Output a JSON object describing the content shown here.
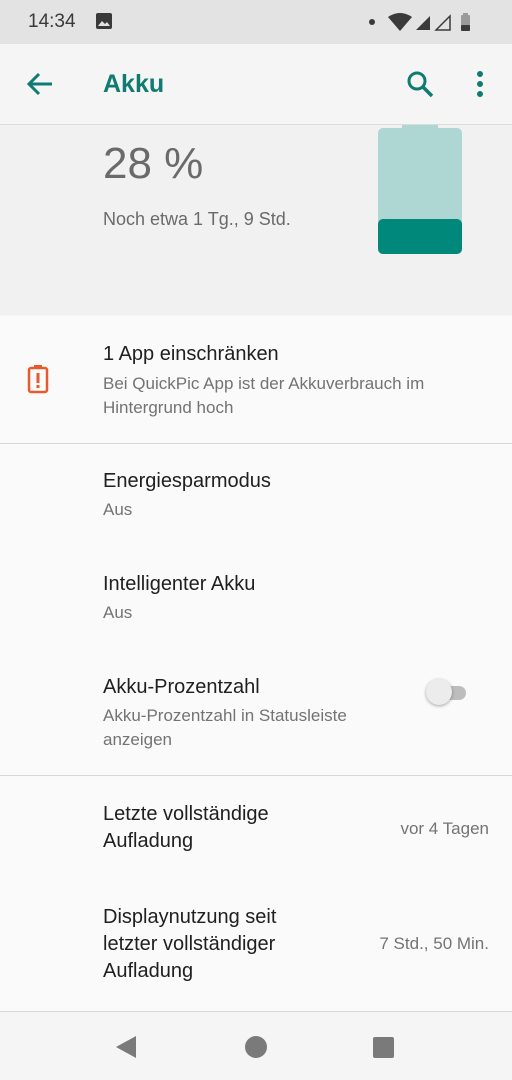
{
  "status_bar": {
    "time": "14:34"
  },
  "app_bar": {
    "title": "Akku",
    "accent_color": "#0f7b71"
  },
  "battery": {
    "percent_text": "28 %",
    "level_fraction": 0.28,
    "remaining": "Noch etwa 1 Tg., 9 Std.",
    "fill_color": "#00897b",
    "empty_color": "#aed7d3"
  },
  "restrict_app": {
    "title": "1 App einschränken",
    "subtitle_line1": "Bei QuickPic App ist der Akkuverbrauch im",
    "subtitle_line2": "Hintergrund hoch",
    "icon_color": "#e65a2b"
  },
  "settings": {
    "energy_saver": {
      "title": "Energiesparmodus",
      "subtitle": "Aus"
    },
    "smart_battery": {
      "title": "Intelligenter Akku",
      "subtitle": "Aus"
    },
    "battery_percentage": {
      "title": "Akku-Prozentzahl",
      "subtitle_line1": "Akku-Prozentzahl in Statusleiste",
      "subtitle_line2": "anzeigen",
      "enabled": false
    }
  },
  "usage": {
    "last_full_charge": {
      "title_line1": "Letzte vollständige",
      "title_line2": "Aufladung",
      "value": "vor 4 Tagen"
    },
    "screen_usage": {
      "title_line1": "Displaynutzung seit",
      "title_line2": "letzter vollständiger",
      "title_line3": "Aufladung",
      "value": "7 Std., 50 Min."
    }
  },
  "nav_bar": {
    "icons": [
      "back-triangle-icon",
      "home-circle-icon",
      "recents-square-icon"
    ]
  }
}
